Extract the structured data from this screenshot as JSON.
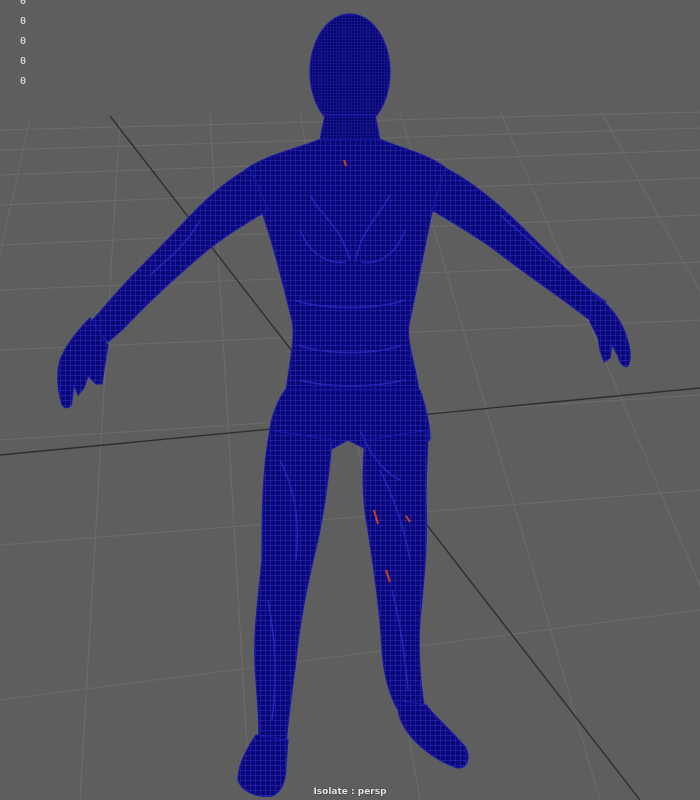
{
  "hud": {
    "values": [
      "0",
      "0",
      "0",
      "0",
      "0"
    ]
  },
  "camera_label": "Isolate : persp",
  "colors": {
    "background": "#5e5e5e",
    "grid_minor": "#707070",
    "grid_major": "#2f2f2f",
    "mesh_fill": "#0a0878",
    "mesh_wire": "#3a3ad0",
    "mesh_highlight": "#c8421e"
  },
  "icons": {
    "model": "wireframe-body-mesh"
  }
}
